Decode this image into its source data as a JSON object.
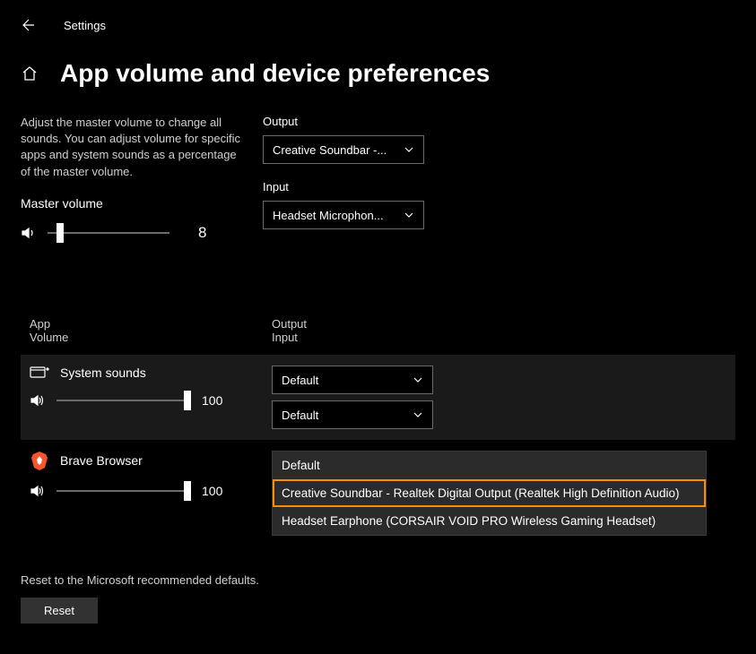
{
  "header": {
    "title": "Settings"
  },
  "page": {
    "title": "App volume and device preferences"
  },
  "description": "Adjust the master volume to change all sounds. You can adjust volume for specific apps and system sounds as a percentage of the master volume.",
  "master": {
    "label": "Master volume",
    "value": 8,
    "display": "8"
  },
  "output": {
    "label": "Output",
    "selected": "Creative Soundbar -..."
  },
  "input": {
    "label": "Input",
    "selected": "Headset Microphon..."
  },
  "list_header": {
    "col1_line1": "App",
    "col1_line2": "Volume",
    "col2_line1": "Output",
    "col2_line2": "Input"
  },
  "apps": {
    "system": {
      "name": "System sounds",
      "volume": 100,
      "display": "100",
      "output": "Default",
      "input": "Default"
    },
    "brave": {
      "name": "Brave Browser",
      "volume": 100,
      "display": "100",
      "dropdown": [
        "Default",
        "Creative Soundbar - Realtek Digital Output (Realtek High Definition Audio)",
        "Headset Earphone (CORSAIR VOID PRO Wireless Gaming Headset)"
      ]
    }
  },
  "reset": {
    "text": "Reset to the Microsoft recommended defaults.",
    "button": "Reset"
  }
}
